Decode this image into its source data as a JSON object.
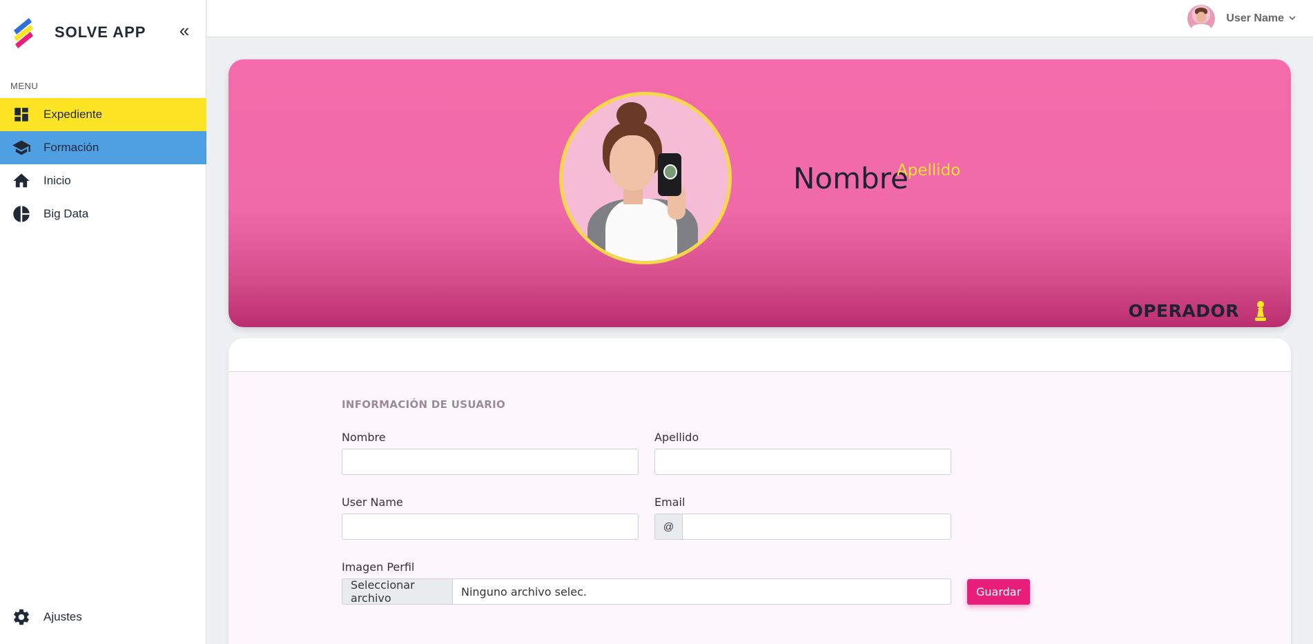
{
  "app": {
    "name": "SOLVE APP",
    "collapse_icon": "double-chevron-left-icon"
  },
  "sidebar": {
    "menu_label": "MENU",
    "items": [
      {
        "label": "Expediente",
        "icon": "dashboard-icon",
        "state": "active-yellow"
      },
      {
        "label": "Formación",
        "icon": "graduation-cap-icon",
        "state": "active-blue"
      },
      {
        "label": "Inicio",
        "icon": "home-icon",
        "state": "normal"
      },
      {
        "label": "Big Data",
        "icon": "pie-chart-icon",
        "state": "normal"
      }
    ],
    "settings_label": "Ajustes"
  },
  "topbar": {
    "user_name": "User Name",
    "chevron": "⌄"
  },
  "profile": {
    "first_name": "Nombre",
    "last_name": "Apellido",
    "role": "OPERADOR",
    "role_icon": "chess-pawn-icon"
  },
  "form": {
    "section_title": "INFORMACIÓN DE USUARIO",
    "nombre_label": "Nombre",
    "nombre_value": "",
    "apellido_label": "Apellido",
    "apellido_value": "",
    "username_label": "User Name",
    "username_value": "",
    "email_label": "Email",
    "email_addon": "@",
    "email_value": "",
    "image_label": "Imagen Perfil",
    "file_button": "Seleccionar archivo",
    "file_name": "Ninguno archivo selec.",
    "save_button": "Guardar"
  },
  "colors": {
    "accent_yellow": "#fde525",
    "accent_blue": "#4f9fe3",
    "hero_pink": "#f06aa9",
    "save_pink": "#e91e7b"
  }
}
